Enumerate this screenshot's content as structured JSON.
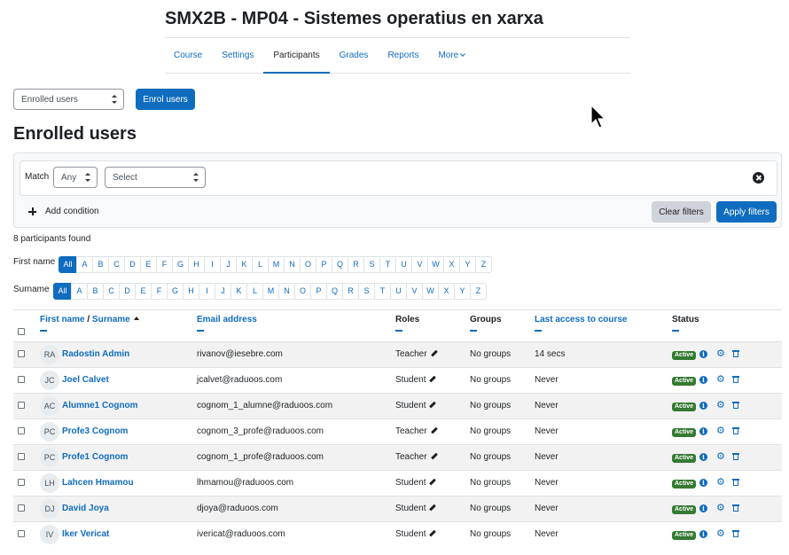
{
  "course": {
    "title": "SMX2B - MP04 - Sistemes operatius en xarxa"
  },
  "nav": {
    "tabs": [
      {
        "label": "Course"
      },
      {
        "label": "Settings"
      },
      {
        "label": "Participants"
      },
      {
        "label": "Grades"
      },
      {
        "label": "Reports"
      },
      {
        "label": "More"
      }
    ],
    "active": "Participants"
  },
  "toolbar": {
    "view_select": "Enrolled users",
    "enrol_button": "Enrol users"
  },
  "heading": "Enrolled users",
  "filters": {
    "match_label": "Match",
    "match_value": "Any",
    "type_value": "Select",
    "add_condition": "Add condition",
    "clear_button": "Clear filters",
    "apply_button": "Apply filters"
  },
  "found_text": "8 participants found",
  "initials": {
    "firstname_label": "First name",
    "surname_label": "Surname",
    "letters": [
      "All",
      "A",
      "B",
      "C",
      "D",
      "E",
      "F",
      "G",
      "H",
      "I",
      "J",
      "K",
      "L",
      "M",
      "N",
      "O",
      "P",
      "Q",
      "R",
      "S",
      "T",
      "U",
      "V",
      "W",
      "X",
      "Y",
      "Z"
    ]
  },
  "table": {
    "headers": {
      "firstname": "First name",
      "sep": " / ",
      "surname": "Surname",
      "email": "Email address",
      "roles": "Roles",
      "groups": "Groups",
      "last_access": "Last access to course",
      "status": "Status"
    },
    "rows": [
      {
        "initials": "RA",
        "name": "Radostin Admin",
        "email": "rivanov@iesebre.com",
        "role": "Teacher",
        "groups": "No groups",
        "last_access": "14 secs",
        "status": "Active"
      },
      {
        "initials": "JC",
        "name": "Joel Calvet",
        "email": "jcalvet@raduoos.com",
        "role": "Student",
        "groups": "No groups",
        "last_access": "Never",
        "status": "Active"
      },
      {
        "initials": "AC",
        "name": "Alumne1 Cognom",
        "email": "cognom_1_alumne@raduoos.com",
        "role": "Student",
        "groups": "No groups",
        "last_access": "Never",
        "status": "Active"
      },
      {
        "initials": "PC",
        "name": "Profe3 Cognom",
        "email": "cognom_3_profe@raduoos.com",
        "role": "Teacher",
        "groups": "No groups",
        "last_access": "Never",
        "status": "Active"
      },
      {
        "initials": "PC",
        "name": "Profe1 Cognom",
        "email": "cognom_1_profe@raduoos.com",
        "role": "Teacher",
        "groups": "No groups",
        "last_access": "Never",
        "status": "Active"
      },
      {
        "initials": "LH",
        "name": "Lahcen Hmamou",
        "email": "lhmamou@raduoos.com",
        "role": "Student",
        "groups": "No groups",
        "last_access": "Never",
        "status": "Active"
      },
      {
        "initials": "DJ",
        "name": "David Joya",
        "email": "djoya@raduoos.com",
        "role": "Student",
        "groups": "No groups",
        "last_access": "Never",
        "status": "Active"
      },
      {
        "initials": "IV",
        "name": "Iker Vericat",
        "email": "ivericat@raduoos.com",
        "role": "Student",
        "groups": "No groups",
        "last_access": "Never",
        "status": "Active"
      }
    ]
  },
  "colors": {
    "primary": "#0f6cbf",
    "active_badge": "#357a32",
    "text": "#1d2125",
    "row_stripe": "#f2f2f2"
  },
  "icons": {
    "row": [
      "info-icon",
      "gear-icon",
      "trash-icon"
    ],
    "role_edit": "pencil-icon",
    "remove_filter": "close-icon",
    "add": "plus-icon"
  }
}
